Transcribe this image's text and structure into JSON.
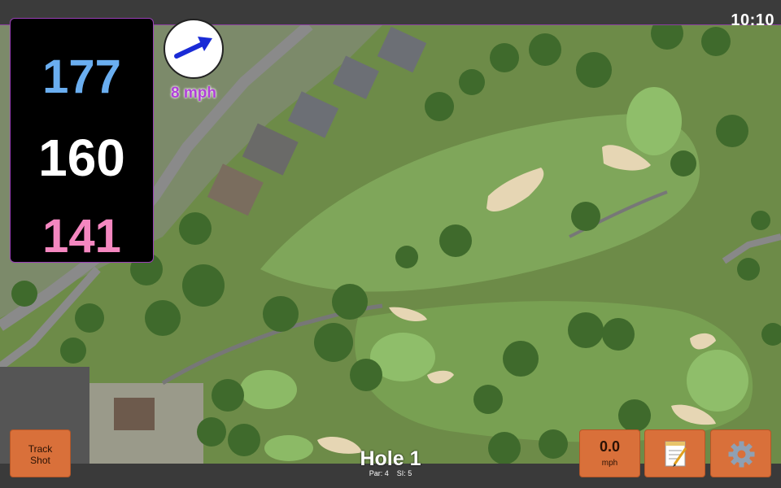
{
  "status": {
    "clock": "10:10"
  },
  "distances": {
    "back": "177",
    "middle": "160",
    "front": "141"
  },
  "wind": {
    "speed_label": "8 mph",
    "direction_icon": "wind-arrow-icon"
  },
  "hole": {
    "title": "Hole 1",
    "par_label": "Par: 4",
    "si_label": "SI: 5"
  },
  "buttons": {
    "track_shot_line1": "Track",
    "track_shot_line2": "Shot",
    "speed_value": "0.0",
    "speed_unit": "mph",
    "notes_icon": "notepad-icon",
    "settings_icon": "gear-icon"
  },
  "colors": {
    "back_distance": "#6aaef0",
    "middle_distance": "#ffffff",
    "front_distance": "#f487c0",
    "button": "#d9703a",
    "wind_label": "#b040d8"
  }
}
